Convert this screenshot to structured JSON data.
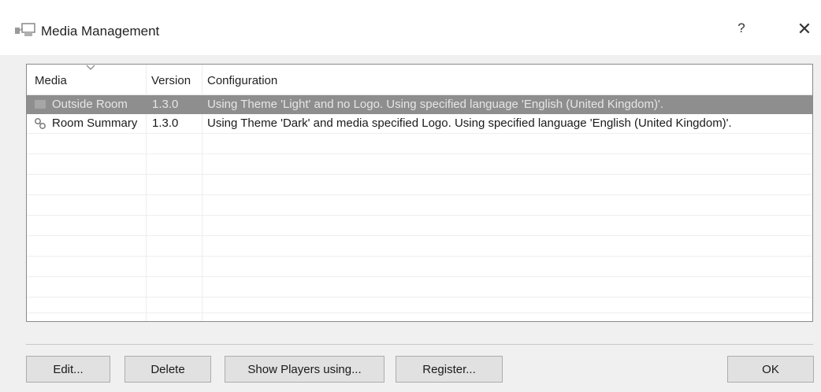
{
  "window": {
    "title": "Media Management",
    "help_label": "?",
    "close_label": "✕"
  },
  "list": {
    "columns": [
      "Media",
      "Version",
      "Configuration"
    ],
    "rows": [
      {
        "name": "Outside Room",
        "version": "1.3.0",
        "configuration": "Using Theme 'Light' and no Logo. Using specified language 'English (United Kingdom)'.",
        "selected": true,
        "icon": "media-item-icon"
      },
      {
        "name": "Room Summary",
        "version": "1.3.0",
        "configuration": "Using Theme 'Dark' and media specified Logo. Using specified language 'English (United Kingdom)'.",
        "selected": false,
        "icon": "linked-media-icon"
      }
    ]
  },
  "buttons": {
    "edit": "Edit...",
    "delete": "Delete",
    "show_players": "Show Players using...",
    "register": "Register...",
    "ok": "OK"
  },
  "colors": {
    "selection": "#8e8e8e",
    "dialog_bg": "#f0f0f0",
    "button_bg": "#e1e1e1"
  }
}
